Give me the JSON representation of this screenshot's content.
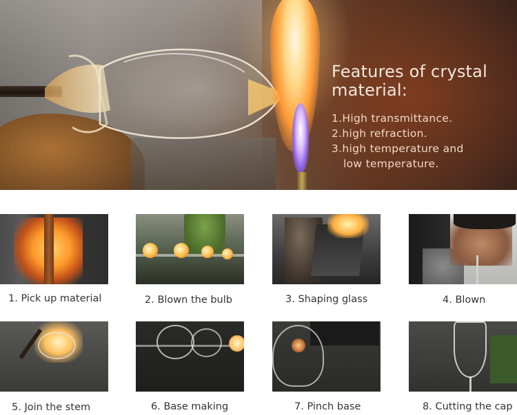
{
  "hero": {
    "title": "Features of crystal material:",
    "features": [
      "1.High transmittance.",
      "2.high refraction.",
      "3.high temperature and",
      "low temperature."
    ]
  },
  "steps": [
    {
      "caption": "1. Pick up material"
    },
    {
      "caption": "2. Blown the bulb"
    },
    {
      "caption": "3. Shaping glass"
    },
    {
      "caption": "4. Blown"
    },
    {
      "caption": "5. Join the stem"
    },
    {
      "caption": "6. Base making"
    },
    {
      "caption": "7. Pinch base"
    },
    {
      "caption": "8. Cutting the cap"
    }
  ]
}
